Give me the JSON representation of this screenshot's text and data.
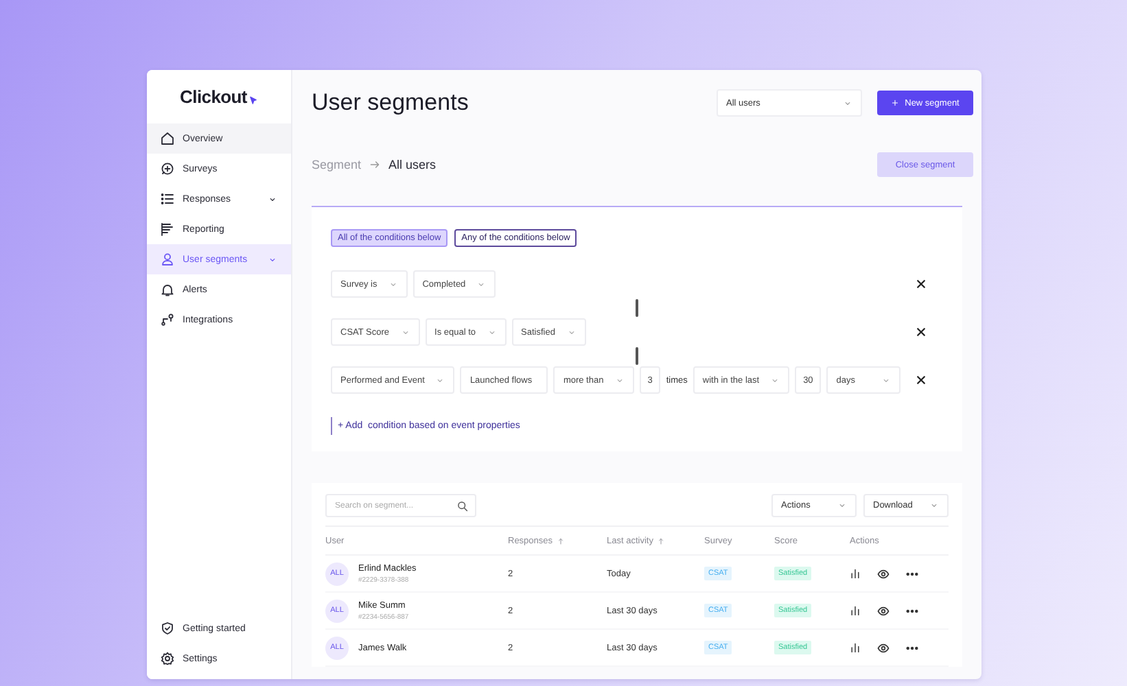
{
  "logo": "Clickout",
  "sidebar": {
    "items": [
      {
        "label": "Overview",
        "expandable": false,
        "selected": false
      },
      {
        "label": "Surveys",
        "expandable": false,
        "selected": false
      },
      {
        "label": "Responses",
        "expandable": true,
        "selected": false
      },
      {
        "label": "Reporting",
        "expandable": false,
        "selected": false
      },
      {
        "label": "User segments",
        "expandable": true,
        "selected": true
      },
      {
        "label": "Alerts",
        "expandable": false,
        "selected": false
      },
      {
        "label": "Integrations",
        "expandable": false,
        "selected": false
      }
    ],
    "footer_items": [
      {
        "label": "Getting started"
      },
      {
        "label": "Settings"
      }
    ]
  },
  "header": {
    "title": "User segments",
    "segment_select": "All users",
    "new_button": "New segment"
  },
  "breadcrumb": {
    "parent": "Segment",
    "current": "All users",
    "close_button": "Close segment"
  },
  "match_options": [
    {
      "label": "All of the conditions below",
      "selected": true
    },
    {
      "label": "Any of the conditions below",
      "selected": false
    }
  ],
  "conditions": [
    {
      "fields": [
        {
          "kind": "select",
          "value": "Survey is"
        },
        {
          "kind": "select",
          "value": "Completed"
        }
      ]
    },
    {
      "fields": [
        {
          "kind": "select",
          "value": "CSAT Score"
        },
        {
          "kind": "select",
          "value": "Is equal to"
        },
        {
          "kind": "select",
          "value": "Satisfied"
        }
      ]
    },
    {
      "fields": [
        {
          "kind": "select",
          "value": "Performed and Event"
        },
        {
          "kind": "input",
          "value": "Launched flows"
        },
        {
          "kind": "select",
          "value": "more than"
        },
        {
          "kind": "number",
          "value": "3"
        },
        {
          "kind": "text",
          "value": "times"
        },
        {
          "kind": "select",
          "value": "with in the last"
        },
        {
          "kind": "number",
          "value": "30"
        },
        {
          "kind": "select",
          "value": "days"
        }
      ]
    }
  ],
  "add_condition": "+ Add  condition based on event properties",
  "table": {
    "search": {
      "placeholder": "Search on segment..."
    },
    "toolbar": [
      {
        "label": "Actions"
      },
      {
        "label": "Download"
      }
    ],
    "columns": [
      {
        "label": "User",
        "sortable": false
      },
      {
        "label": "Responses",
        "sortable": true
      },
      {
        "label": "Last activity",
        "sortable": true
      },
      {
        "label": "Survey",
        "sortable": false
      },
      {
        "label": "Score",
        "sortable": false
      },
      {
        "label": "Actions",
        "sortable": false
      }
    ],
    "rows": [
      {
        "avatar": "ALL",
        "name": "Erlind Mackles",
        "id": "#2229-3378-388",
        "responses": "2",
        "last_activity": "Today",
        "survey": "CSAT",
        "score": "Satisfied"
      },
      {
        "avatar": "ALL",
        "name": "Mike Summ",
        "id": "#2234-5656-887",
        "responses": "2",
        "last_activity": "Last 30 days",
        "survey": "CSAT",
        "score": "Satisfied"
      },
      {
        "avatar": "ALL",
        "name": "James Walk",
        "responses": "2",
        "last_activity": "Last 30 days",
        "survey": "CSAT",
        "score": "Satisfied"
      }
    ]
  }
}
